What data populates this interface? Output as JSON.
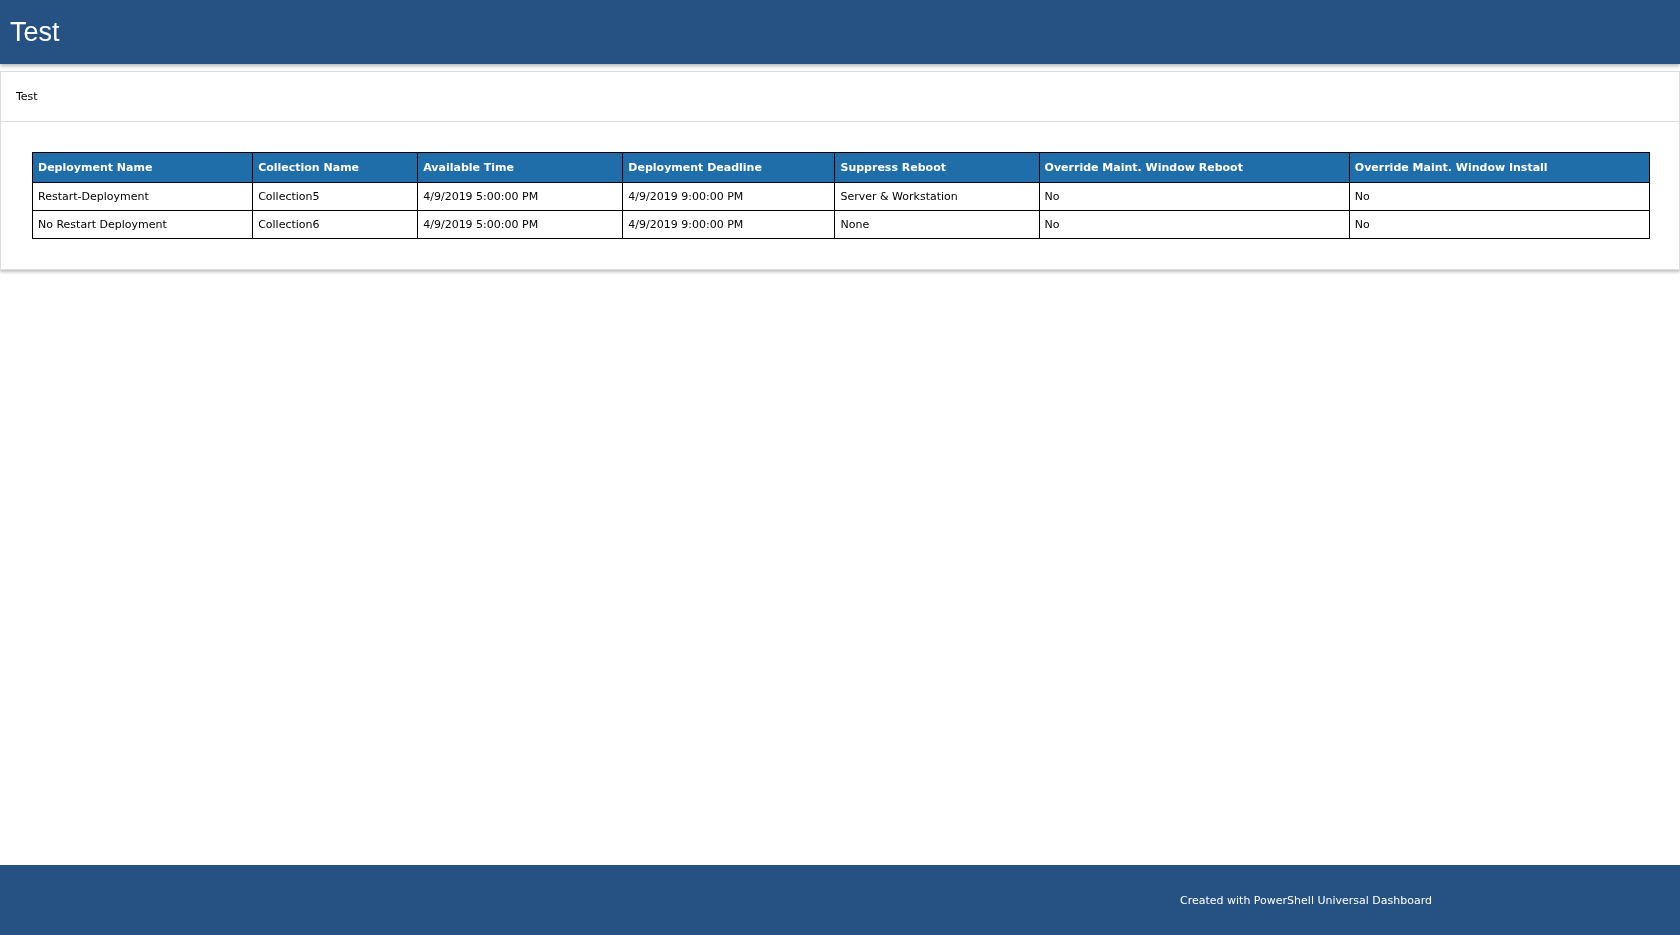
{
  "header": {
    "title": "Test"
  },
  "card": {
    "title": "Test",
    "table": {
      "columns": [
        "Deployment Name",
        "Collection Name",
        "Available Time",
        "Deployment Deadline",
        "Suppress Reboot",
        "Override Maint. Window Reboot",
        "Override Maint. Window Install"
      ],
      "rows": [
        [
          "Restart-Deployment",
          "Collection5",
          "4/9/2019 5:00:00 PM",
          "4/9/2019 9:00:00 PM",
          "Server & Workstation",
          "No",
          "No"
        ],
        [
          "No Restart Deployment",
          "Collection6",
          "4/9/2019 5:00:00 PM",
          "4/9/2019 9:00:00 PM",
          "None",
          "No",
          "No"
        ]
      ]
    }
  },
  "footer": {
    "text": "Created with PowerShell Universal Dashboard"
  }
}
